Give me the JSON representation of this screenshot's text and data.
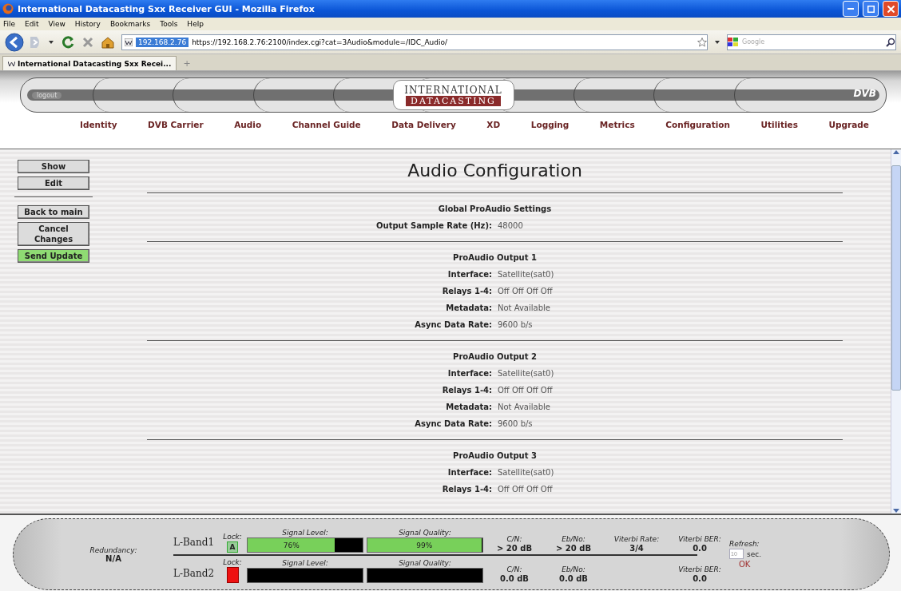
{
  "window": {
    "title": "International Datacasting Sxx Receiver GUI - Mozilla Firefox"
  },
  "menu": [
    "File",
    "Edit",
    "View",
    "History",
    "Bookmarks",
    "Tools",
    "Help"
  ],
  "address_bar": {
    "site_identity": "192.168.2.76",
    "url": "https://192.168.2.76:2100/index.cgi?cat=3Audio&module=/IDC_Audio/"
  },
  "search": {
    "placeholder": "Google"
  },
  "tabs": [
    {
      "label": "International Datacasting Sxx Recei...",
      "selected": true
    }
  ],
  "new_tab": "+",
  "header": {
    "logout": "logout",
    "logo_top": "INTERNATIONAL",
    "logo_bottom": "DATACASTING",
    "badge": "DVB"
  },
  "nav": [
    "Identity",
    "DVB Carrier",
    "Audio",
    "Channel Guide",
    "Data Delivery",
    "XD",
    "Logging",
    "Metrics",
    "Configuration",
    "Utilities",
    "Upgrade"
  ],
  "sidebar": [
    {
      "kind": "button",
      "label": "Show"
    },
    {
      "kind": "button",
      "label": "Edit"
    },
    {
      "kind": "divider"
    },
    {
      "kind": "button",
      "label": "Back to main"
    },
    {
      "kind": "button",
      "label": "Cancel Changes"
    },
    {
      "kind": "primary",
      "label": "Send Update"
    }
  ],
  "page": {
    "title": "Audio Configuration",
    "sections": [
      {
        "heading": "Global ProAudio Settings",
        "fields": [
          {
            "label": "Output Sample Rate (Hz):",
            "value": "48000"
          }
        ]
      },
      {
        "heading": "ProAudio Output 1",
        "fields": [
          {
            "label": "Interface:",
            "value": "Satellite(sat0)"
          },
          {
            "label": "Relays 1-4:",
            "value": "Off Off Off Off"
          },
          {
            "label": "Metadata:",
            "value": "Not Available"
          },
          {
            "label": "Async Data Rate:",
            "value": "9600 b/s"
          }
        ]
      },
      {
        "heading": "ProAudio Output 2",
        "fields": [
          {
            "label": "Interface:",
            "value": "Satellite(sat0)"
          },
          {
            "label": "Relays 1-4:",
            "value": "Off Off Off Off"
          },
          {
            "label": "Metadata:",
            "value": "Not Available"
          },
          {
            "label": "Async Data Rate:",
            "value": "9600 b/s"
          }
        ]
      },
      {
        "heading": "ProAudio Output 3",
        "fields": [
          {
            "label": "Interface:",
            "value": "Satellite(sat0)"
          },
          {
            "label": "Relays 1-4:",
            "value": "Off Off Off Off"
          }
        ]
      }
    ]
  },
  "status": {
    "redundancy_label": "Redundancy:",
    "redundancy": "N/A",
    "bands": [
      {
        "name": "L-Band1",
        "lock_label": "Lock:",
        "locked": true,
        "lock_text": "A",
        "signal_label": "Signal Level:",
        "signal": {
          "level": 0.76,
          "reading": "76%"
        },
        "quality_label": "Signal Quality:",
        "quality": {
          "level": 0.99,
          "reading": "99%"
        },
        "cn": {
          "label": "C/N:",
          "value": "> 20 dB"
        },
        "ebno": {
          "label": "Eb/No:",
          "value": "> 20 dB"
        },
        "viterbi_rate": {
          "label": "Viterbi Rate:",
          "value": "3/4"
        },
        "viterbi_ber": {
          "label": "Viterbi BER:",
          "value": "0.0"
        }
      },
      {
        "name": "L-Band2",
        "lock_label": "Lock:",
        "locked": false,
        "signal_label": "Signal Level:",
        "signal": {
          "level": 0
        },
        "quality_label": "Signal Quality:",
        "quality": {
          "level": 0
        },
        "cn": {
          "label": "C/N:",
          "value": "0.0 dB"
        },
        "ebno": {
          "label": "Eb/No:",
          "value": "0.0 dB"
        },
        "viterbi_ber": {
          "label": "Viterbi BER:",
          "value": "0.0"
        }
      }
    ],
    "refresh": {
      "label": "Refresh:",
      "value": "10",
      "unit": "sec.",
      "status": "OK"
    }
  }
}
